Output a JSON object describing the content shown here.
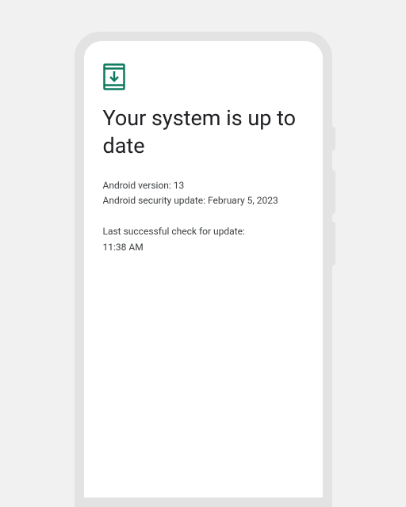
{
  "update": {
    "title": "Your system is up to date",
    "version_line": "Android version: 13",
    "security_line": "Android security update: February 5, 2023",
    "last_check_label": "Last successful check for update:",
    "last_check_time": "11:38 AM"
  },
  "colors": {
    "accent": "#0d7a5f"
  }
}
